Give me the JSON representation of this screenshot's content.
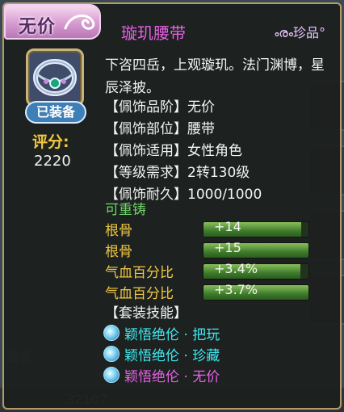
{
  "background": {
    "bottom_label": "装备",
    "bottom_number": "32107"
  },
  "header": {
    "tier_badge": "无价",
    "item_name": "璇玑腰带",
    "rarity_tag": "珍品"
  },
  "item": {
    "icon": "belt-icon",
    "equipped_label": "已装备",
    "score_label": "评分:",
    "score_value": "2220",
    "description": "下咨四岳，上观璇玑。法门渊博，星辰泽披。"
  },
  "attributes": [
    {
      "key": "【佩饰品阶】",
      "value": "无价"
    },
    {
      "key": "【佩饰部位】",
      "value": "腰带"
    },
    {
      "key": "【佩饰适用】",
      "value": "女性角色"
    },
    {
      "key": "【等级需求】",
      "value": "2转130级"
    },
    {
      "key": "【佩饰耐久】",
      "value": "1000/1000"
    }
  ],
  "recast_label": "可重铸",
  "stats": [
    {
      "name": "根骨",
      "value": "+14",
      "fill": 0.93
    },
    {
      "name": "根骨",
      "value": "+15",
      "fill": 1.0
    },
    {
      "name": "气血百分比",
      "value": "+3.4%",
      "fill": 0.92
    },
    {
      "name": "气血百分比",
      "value": "+3.7%",
      "fill": 1.0
    }
  ],
  "set_header": "【套装技能】",
  "set_skills": [
    {
      "label": "颖悟绝伦 · 把玩",
      "color": "#3fe9f0"
    },
    {
      "label": "颖悟绝伦 · 珍藏",
      "color": "#3fe9f0"
    },
    {
      "label": "颖悟绝伦 · 无价",
      "color": "#e85fe6"
    }
  ],
  "colors": {
    "name_color": "#e85fe6",
    "score_label": "#f0c840",
    "stat_name": "#f0c840",
    "recast": "#6fd36a"
  }
}
